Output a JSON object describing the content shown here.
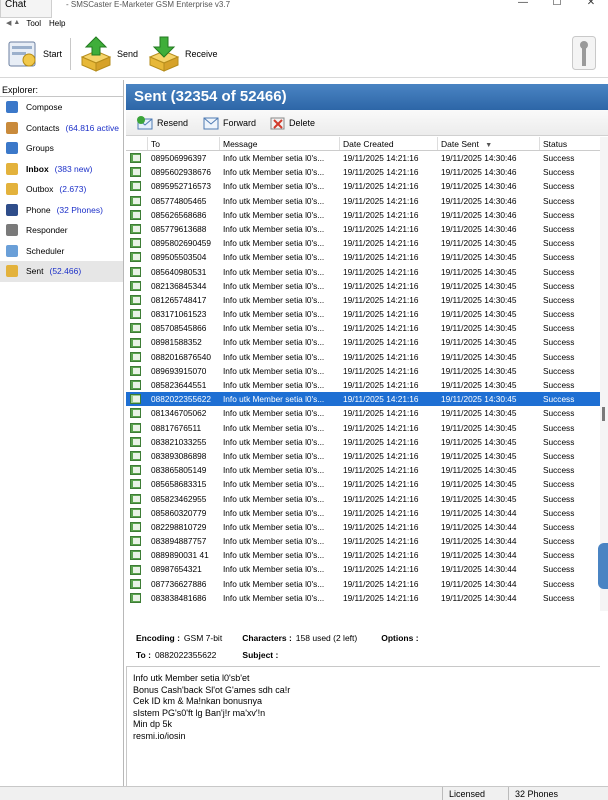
{
  "chat_tab": "Chat",
  "title": "- SMSCaster E-Marketer GSM Enterprise v3.7",
  "window_controls": [
    "—",
    "☐",
    "✕"
  ],
  "menu": [
    "Tool",
    "Help"
  ],
  "toolbar": {
    "start": "Start",
    "send": "Send",
    "receive": "Receive"
  },
  "explorer": {
    "header": "Explorer:",
    "items": [
      {
        "label": "Compose",
        "count": "",
        "icon": "compose-icon"
      },
      {
        "label": "Contacts",
        "count": "(64.816 active",
        "icon": "contacts-icon"
      },
      {
        "label": "Groups",
        "count": "",
        "icon": "groups-icon"
      },
      {
        "label": "Inbox",
        "count": "(383 new)",
        "icon": "inbox-icon",
        "bold": true
      },
      {
        "label": "Outbox",
        "count": "(2.673)",
        "icon": "outbox-icon"
      },
      {
        "label": "Phone",
        "count": "(32 Phones)",
        "icon": "phone-icon"
      },
      {
        "label": "Responder",
        "count": "",
        "icon": "responder-icon"
      },
      {
        "label": "Scheduler",
        "count": "",
        "icon": "scheduler-icon"
      },
      {
        "label": "Sent",
        "count": "(52.466)",
        "icon": "sent-icon",
        "selected": true
      }
    ]
  },
  "sent_header": "Sent (32354 of 52466)",
  "actions": {
    "resend": "Resend",
    "forward": "Forward",
    "delete": "Delete"
  },
  "columns": [
    "To",
    "Message",
    "Date Created",
    "Date Sent",
    "Status"
  ],
  "rows": [
    {
      "to": "089506996397",
      "msg": "Info utk Member setia l0's...",
      "dc": "19/11/2025 14:21:16",
      "ds": "19/11/2025 14:30:46",
      "st": "Success"
    },
    {
      "to": "0895602938676",
      "msg": "Info utk Member setia l0's...",
      "dc": "19/11/2025 14:21:16",
      "ds": "19/11/2025 14:30:46",
      "st": "Success"
    },
    {
      "to": "0895952716573",
      "msg": "Info utk Member setia l0's...",
      "dc": "19/11/2025 14:21:16",
      "ds": "19/11/2025 14:30:46",
      "st": "Success"
    },
    {
      "to": "085774805465",
      "msg": "Info utk Member setia l0's...",
      "dc": "19/11/2025 14:21:16",
      "ds": "19/11/2025 14:30:46",
      "st": "Success"
    },
    {
      "to": "085626568686",
      "msg": "Info utk Member setia l0's...",
      "dc": "19/11/2025 14:21:16",
      "ds": "19/11/2025 14:30:46",
      "st": "Success"
    },
    {
      "to": "085779613688",
      "msg": "Info utk Member setia l0's...",
      "dc": "19/11/2025 14:21:16",
      "ds": "19/11/2025 14:30:46",
      "st": "Success"
    },
    {
      "to": "0895802690459",
      "msg": "Info utk Member setia l0's...",
      "dc": "19/11/2025 14:21:16",
      "ds": "19/11/2025 14:30:45",
      "st": "Success"
    },
    {
      "to": "089505503504",
      "msg": "Info utk Member setia l0's...",
      "dc": "19/11/2025 14:21:16",
      "ds": "19/11/2025 14:30:45",
      "st": "Success"
    },
    {
      "to": "085640980531",
      "msg": "Info utk Member setia l0's...",
      "dc": "19/11/2025 14:21:16",
      "ds": "19/11/2025 14:30:45",
      "st": "Success"
    },
    {
      "to": "082136845344",
      "msg": "Info utk Member setia l0's...",
      "dc": "19/11/2025 14:21:16",
      "ds": "19/11/2025 14:30:45",
      "st": "Success"
    },
    {
      "to": "081265748417",
      "msg": "Info utk Member setia l0's...",
      "dc": "19/11/2025 14:21:16",
      "ds": "19/11/2025 14:30:45",
      "st": "Success"
    },
    {
      "to": "083171061523",
      "msg": "Info utk Member setia l0's...",
      "dc": "19/11/2025 14:21:16",
      "ds": "19/11/2025 14:30:45",
      "st": "Success"
    },
    {
      "to": "085708545866",
      "msg": "Info utk Member setia l0's...",
      "dc": "19/11/2025 14:21:16",
      "ds": "19/11/2025 14:30:45",
      "st": "Success"
    },
    {
      "to": "08981588352",
      "msg": "Info utk Member setia l0's...",
      "dc": "19/11/2025 14:21:16",
      "ds": "19/11/2025 14:30:45",
      "st": "Success"
    },
    {
      "to": "0882016876540",
      "msg": "Info utk Member setia l0's...",
      "dc": "19/11/2025 14:21:16",
      "ds": "19/11/2025 14:30:45",
      "st": "Success"
    },
    {
      "to": "089693915070",
      "msg": "Info utk Member setia l0's...",
      "dc": "19/11/2025 14:21:16",
      "ds": "19/11/2025 14:30:45",
      "st": "Success"
    },
    {
      "to": "085823644551",
      "msg": "Info utk Member setia l0's...",
      "dc": "19/11/2025 14:21:16",
      "ds": "19/11/2025 14:30:45",
      "st": "Success"
    },
    {
      "to": "0882022355622",
      "msg": "Info utk Member setia l0's...",
      "dc": "19/11/2025 14:21:16",
      "ds": "19/11/2025 14:30:45",
      "st": "Success",
      "selected": true
    },
    {
      "to": "081346705062",
      "msg": "Info utk Member setia l0's...",
      "dc": "19/11/2025 14:21:16",
      "ds": "19/11/2025 14:30:45",
      "st": "Success"
    },
    {
      "to": "08817676511",
      "msg": "Info utk Member setia l0's...",
      "dc": "19/11/2025 14:21:16",
      "ds": "19/11/2025 14:30:45",
      "st": "Success"
    },
    {
      "to": "083821033255",
      "msg": "Info utk Member setia l0's...",
      "dc": "19/11/2025 14:21:16",
      "ds": "19/11/2025 14:30:45",
      "st": "Success"
    },
    {
      "to": "083893086898",
      "msg": "Info utk Member setia l0's...",
      "dc": "19/11/2025 14:21:16",
      "ds": "19/11/2025 14:30:45",
      "st": "Success"
    },
    {
      "to": "083865805149",
      "msg": "Info utk Member setia l0's...",
      "dc": "19/11/2025 14:21:16",
      "ds": "19/11/2025 14:30:45",
      "st": "Success"
    },
    {
      "to": "085658683315",
      "msg": "Info utk Member setia l0's...",
      "dc": "19/11/2025 14:21:16",
      "ds": "19/11/2025 14:30:45",
      "st": "Success"
    },
    {
      "to": "085823462955",
      "msg": "Info utk Member setia l0's...",
      "dc": "19/11/2025 14:21:16",
      "ds": "19/11/2025 14:30:45",
      "st": "Success"
    },
    {
      "to": "085860320779",
      "msg": "Info utk Member setia l0's...",
      "dc": "19/11/2025 14:21:16",
      "ds": "19/11/2025 14:30:44",
      "st": "Success"
    },
    {
      "to": "082298810729",
      "msg": "Info utk Member setia l0's...",
      "dc": "19/11/2025 14:21:16",
      "ds": "19/11/2025 14:30:44",
      "st": "Success"
    },
    {
      "to": "083894887757",
      "msg": "Info utk Member setia l0's...",
      "dc": "19/11/2025 14:21:16",
      "ds": "19/11/2025 14:30:44",
      "st": "Success"
    },
    {
      "to": "0889890031 41",
      "msg": "Info utk Member setia l0's...",
      "dc": "19/11/2025 14:21:16",
      "ds": "19/11/2025 14:30:44",
      "st": "Success"
    },
    {
      "to": "08987654321",
      "msg": "Info utk Member setia l0's...",
      "dc": "19/11/2025 14:21:16",
      "ds": "19/11/2025 14:30:44",
      "st": "Success"
    },
    {
      "to": "087736627886",
      "msg": "Info utk Member setia l0's...",
      "dc": "19/11/2025 14:21:16",
      "ds": "19/11/2025 14:30:44",
      "st": "Success"
    },
    {
      "to": "083838481686",
      "msg": "Info utk Member setia l0's...",
      "dc": "19/11/2025 14:21:16",
      "ds": "19/11/2025 14:30:44",
      "st": "Success"
    }
  ],
  "details": {
    "encoding_label": "Encoding :",
    "encoding_value": "GSM 7-bit",
    "characters_label": "Characters :",
    "characters_value": "158 used (2 left)",
    "options_label": "Options :",
    "to_label": "To :",
    "to_value": "0882022355622",
    "subject_label": "Subject :",
    "message_lines": [
      "Info utk Member setia l0'sb'et",
      "Bonus Cash'back Sl'ot G'ames sdh ca!r",
      "Cek ID km & Ma!nkan bonusnya",
      "sIstem PG's0'ft lg Ban'j!r ma'xv'!n",
      "Min dp 5k",
      "resmi.io/iosin"
    ]
  },
  "statusbar": {
    "licensed": "Licensed",
    "phones": "32 Phones"
  },
  "colors": {
    "header_blue": "#2d66a7",
    "selection_blue": "#1e6fd3",
    "count_blue": "#1b2fc8"
  }
}
